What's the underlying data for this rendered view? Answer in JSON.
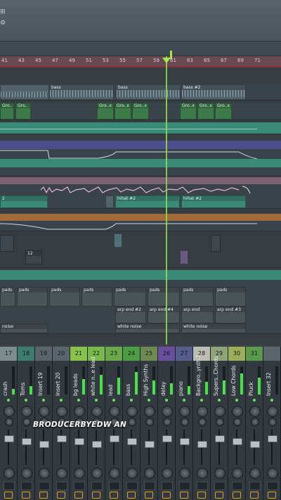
{
  "ruler": {
    "ticks": [
      "41",
      "43",
      "45",
      "47",
      "49",
      "51",
      "53",
      "55",
      "57",
      "59",
      "61",
      "63",
      "65",
      "67",
      "69",
      "71"
    ]
  },
  "playlist": {
    "clips": {
      "bass_a": "bass",
      "bass_b": "bass",
      "bass_c": "bass #2",
      "gro_1": "Gro..",
      "gro_2": "Gro..",
      "gro_3": "Gro..x",
      "gro_4": "Gro..x",
      "gro_5": "Gro..x",
      "gro_6": "Gro..x",
      "gro_7": "Gro..x",
      "gro_8": "Gro..x",
      "h2_left": "2",
      "hihat_a": "hihat #2",
      "hihat_b": "hihat #2",
      "pad_val": "12",
      "pads_1": "pads",
      "pads_2": "pads",
      "pads_3": "pads",
      "pads_4": "pads",
      "pads_5": "pads",
      "pads_6": "pads",
      "pads_7": "pads",
      "pads_8": "pads",
      "arp_a": "arp end #2",
      "arp_b": "arp end #4",
      "arp_c": "arp end",
      "arp_d": "arp end #3",
      "noise_left": "noise",
      "white_noise_a": "white noise",
      "white_noise_b": "white noise"
    }
  },
  "mixer": {
    "strips": [
      {
        "num": "17",
        "name": "crash",
        "color": "#7c8c8f",
        "level": 0.2
      },
      {
        "num": "18",
        "name": "Toms",
        "color": "#3f7a6e",
        "level": 0.3
      },
      {
        "num": "19",
        "name": "Insert 19",
        "color": "#59656b",
        "level": 0
      },
      {
        "num": "20",
        "name": "Insert 20",
        "color": "#59656b",
        "level": 0
      },
      {
        "num": "21",
        "name": "bg leads",
        "color": "#89c24a",
        "level": 0.55
      },
      {
        "num": "22",
        "name": "white n..e lead",
        "color": "#7ab84a",
        "level": 0.7
      },
      {
        "num": "23",
        "name": "lead",
        "color": "#6aa84a",
        "level": 0.6
      },
      {
        "num": "24",
        "name": "bass",
        "color": "#4d9c44",
        "level": 0.8
      },
      {
        "num": "25",
        "name": "High Synths",
        "color": "#6d8a52",
        "level": 0.5
      },
      {
        "num": "26",
        "name": "delay",
        "color": "#6a4f9c",
        "level": 0.4
      },
      {
        "num": "27",
        "name": "piano",
        "color": "#555e8a",
        "level": 0.3
      },
      {
        "num": "28",
        "name": "Backgro..ynth 1",
        "color": "#b9bdb2",
        "level": 0.45
      },
      {
        "num": "29",
        "name": "Supers..Chords",
        "color": "#8fa37a",
        "level": 0.5
      },
      {
        "num": "30",
        "name": "Low Chords",
        "color": "#9cae58",
        "level": 0.75
      },
      {
        "num": "31",
        "name": "Pluck",
        "color": "#5b9a4c",
        "level": 0.6
      },
      {
        "num": "",
        "name": "Insert 32",
        "color": "#59656b",
        "level": 0
      }
    ]
  },
  "watermark": "BRODUCERBYEDW AN",
  "colors": {
    "playhead": "#8fe04a",
    "ruler": "#6a4a52",
    "accent_green": "#6be35e",
    "route": "#e7a21c"
  }
}
